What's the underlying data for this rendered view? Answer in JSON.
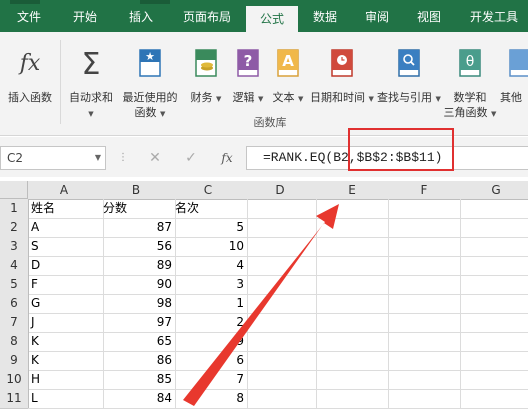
{
  "ribbon": {
    "tabs": [
      {
        "label": "文件",
        "active": false
      },
      {
        "label": "开始",
        "active": false
      },
      {
        "label": "插入",
        "active": false
      },
      {
        "label": "页面布局",
        "active": false
      },
      {
        "label": "公式",
        "active": true
      },
      {
        "label": "数据",
        "active": false
      },
      {
        "label": "审阅",
        "active": false
      },
      {
        "label": "视图",
        "active": false
      },
      {
        "label": "开发工具",
        "active": false
      }
    ],
    "buttons": [
      {
        "line1": "插入函数",
        "line2": "",
        "icon": "insert-function-icon"
      },
      {
        "line1": "自动求和",
        "line2": "",
        "icon": "autosum-icon"
      },
      {
        "line1": "最近使用的",
        "line2": "函数",
        "icon": "recent-functions-icon"
      },
      {
        "line1": "财务",
        "line2": "",
        "icon": "financial-icon"
      },
      {
        "line1": "逻辑",
        "line2": "",
        "icon": "logical-icon"
      },
      {
        "line1": "文本",
        "line2": "",
        "icon": "text-icon"
      },
      {
        "line1": "日期和时间",
        "line2": "",
        "icon": "date-time-icon"
      },
      {
        "line1": "查找与引用",
        "line2": "",
        "icon": "lookup-reference-icon"
      },
      {
        "line1": "数学和",
        "line2": "三角函数",
        "icon": "math-trig-icon"
      },
      {
        "line1": "其他",
        "line2": "",
        "icon": "more-functions-icon"
      }
    ],
    "group_label": "函数库",
    "colors": {
      "brand": "#217346"
    }
  },
  "formula_bar": {
    "name_box": "C2",
    "cancel_symbol": "✕",
    "enter_symbol": "✓",
    "fx_symbol": "fx",
    "formula": "=RANK.EQ(B2,$B$2:$B$11)",
    "highlight_color": "#e03030"
  },
  "sheet": {
    "columns": [
      "A",
      "B",
      "C",
      "D",
      "E",
      "F",
      "G"
    ],
    "rows": [
      [
        "姓名",
        "分数",
        "名次"
      ],
      [
        "A",
        "87",
        "5"
      ],
      [
        "S",
        "56",
        "10"
      ],
      [
        "D",
        "89",
        "4"
      ],
      [
        "F",
        "90",
        "3"
      ],
      [
        "G",
        "98",
        "1"
      ],
      [
        "J",
        "97",
        "2"
      ],
      [
        "K",
        "65",
        "9"
      ],
      [
        "K",
        "86",
        "6"
      ],
      [
        "H",
        "85",
        "7"
      ],
      [
        "L",
        "84",
        "8"
      ]
    ]
  },
  "annotation": {
    "arrow_color": "#e8382e"
  }
}
